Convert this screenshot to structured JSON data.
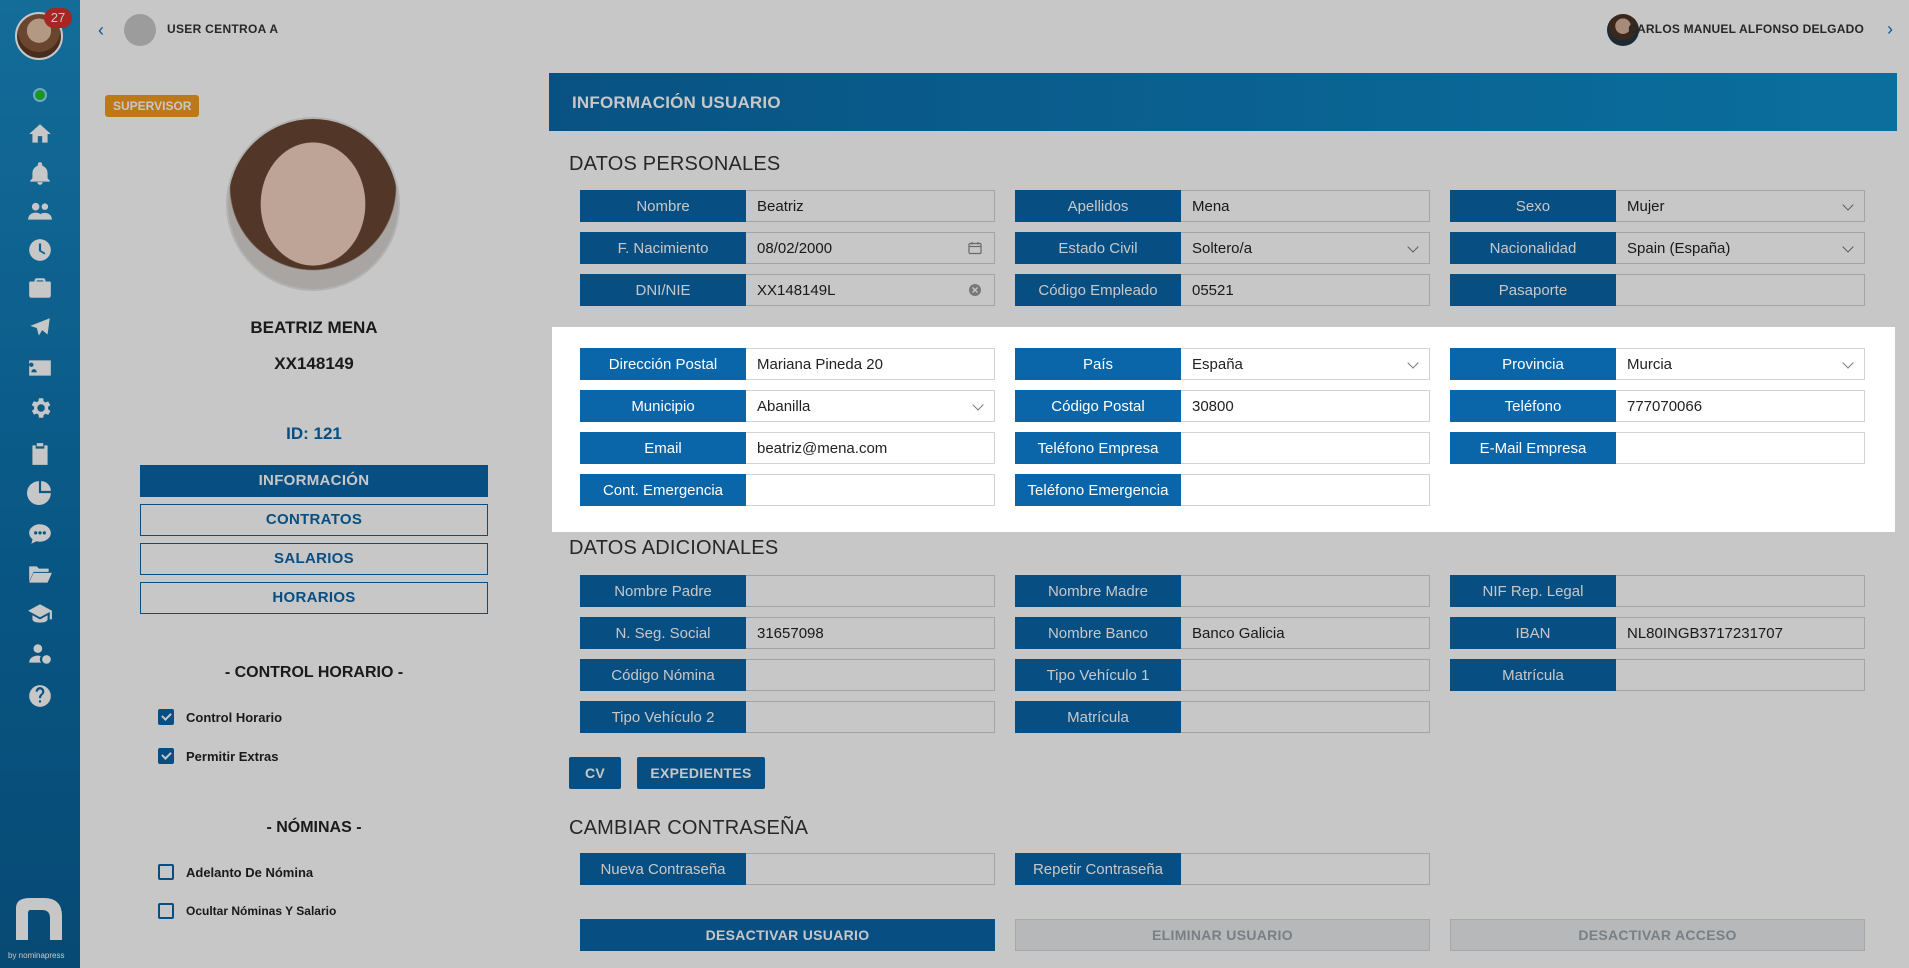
{
  "sidebar": {
    "notification_count": "27",
    "brand_text": "by nominapress",
    "icons": [
      "home-icon",
      "bell-icon",
      "users-icon",
      "clock-icon",
      "briefcase-icon",
      "plane-icon",
      "id-card-icon",
      "gear-icon",
      "clipboard-icon",
      "pie-chart-icon",
      "chat-icon",
      "folder-icon",
      "graduation-icon",
      "user-money-icon",
      "help-icon"
    ]
  },
  "topbar": {
    "center_name": "USER CENTROA A",
    "user_name": "CARLOS MANUEL ALFONSO DELGADO"
  },
  "profile": {
    "role": "SUPERVISOR",
    "full_name": "BEATRIZ MENA",
    "dni": "XX148149",
    "id_label": "ID: 121",
    "tabs": [
      "INFORMACIÓN",
      "CONTRATOS",
      "SALARIOS",
      "HORARIOS"
    ],
    "control_title": "- CONTROL HORARIO -",
    "control_items": [
      {
        "label": "Control Horario",
        "checked": true
      },
      {
        "label": "Permitir Extras",
        "checked": true
      }
    ],
    "nominas_title": "- NÓMINAS -",
    "nominas_items": [
      {
        "label": "Adelanto De Nómina",
        "checked": false
      },
      {
        "label": "Ocultar Nóminas Y Salario",
        "checked": false
      }
    ]
  },
  "main": {
    "header": "INFORMACIÓN USUARIO",
    "personal_title": "DATOS PERSONALES",
    "personal": [
      {
        "label": "Nombre",
        "value": "Beatriz"
      },
      {
        "label": "Apellidos",
        "value": "Mena"
      },
      {
        "label": "Sexo",
        "value": "Mujer"
      },
      {
        "label": "F. Nacimiento",
        "value": "08/02/2000"
      },
      {
        "label": "Estado Civil",
        "value": "Soltero/a"
      },
      {
        "label": "Nacionalidad",
        "value": "Spain (España)"
      },
      {
        "label": "DNI/NIE",
        "value": "XX148149L"
      },
      {
        "label": "Código Empleado",
        "value": "05521"
      },
      {
        "label": "Pasaporte",
        "value": ""
      }
    ],
    "contact": [
      {
        "label": "Dirección Postal",
        "value": "Mariana Pineda 20"
      },
      {
        "label": "País",
        "value": "España"
      },
      {
        "label": "Provincia",
        "value": "Murcia"
      },
      {
        "label": "Municipio",
        "value": "Abanilla"
      },
      {
        "label": "Código Postal",
        "value": "30800"
      },
      {
        "label": "Teléfono",
        "value": "777070066"
      },
      {
        "label": "Email",
        "value": "beatriz@mena.com"
      },
      {
        "label": "Teléfono Empresa",
        "value": ""
      },
      {
        "label": "E-Mail Empresa",
        "value": ""
      },
      {
        "label": "Cont. Emergencia",
        "value": ""
      },
      {
        "label": "Teléfono Emergencia",
        "value": ""
      }
    ],
    "additional_title": "DATOS ADICIONALES",
    "additional": [
      {
        "label": "Nombre Padre",
        "value": ""
      },
      {
        "label": "Nombre Madre",
        "value": ""
      },
      {
        "label": "NIF Rep. Legal",
        "value": ""
      },
      {
        "label": "N. Seg. Social",
        "value": "31657098"
      },
      {
        "label": "Nombre Banco",
        "value": "Banco Galicia"
      },
      {
        "label": "IBAN",
        "value": "NL80INGB3717231707"
      },
      {
        "label": "Código Nómina",
        "value": ""
      },
      {
        "label": "Tipo Vehículo 1",
        "value": ""
      },
      {
        "label": "Matrícula",
        "value": ""
      },
      {
        "label": "Tipo Vehículo 2",
        "value": ""
      },
      {
        "label": "Matrícula",
        "value": ""
      }
    ],
    "cv_button": "CV",
    "expedientes_button": "EXPEDIENTES",
    "password_title": "CAMBIAR CONTRASEÑA",
    "password": [
      {
        "label": "Nueva Contraseña",
        "value": ""
      },
      {
        "label": "Repetir Contraseña",
        "value": ""
      }
    ],
    "actions": [
      "DESACTIVAR USUARIO",
      "ELIMINAR USUARIO",
      "DESACTIVAR ACCESO"
    ]
  }
}
